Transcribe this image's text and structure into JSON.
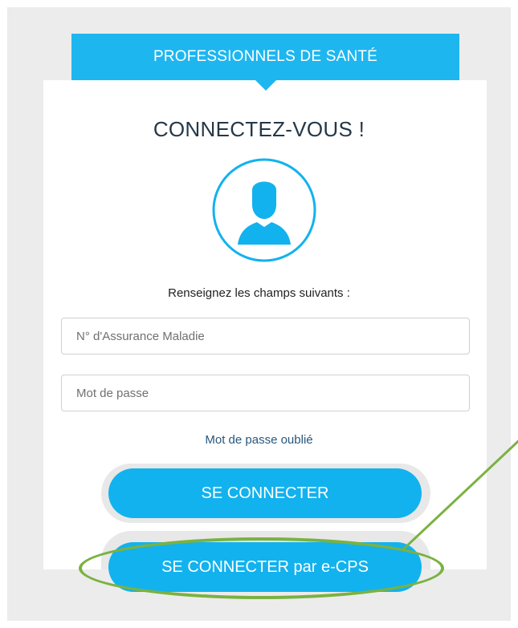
{
  "header": {
    "title": "PROFESSIONNELS DE SANTÉ"
  },
  "login": {
    "title": "CONNECTEZ-VOUS !",
    "instructions": "Renseignez les champs suivants :",
    "fields": {
      "insurance_number_placeholder": "N° d'Assurance Maladie",
      "password_placeholder": "Mot de passe"
    },
    "forgot_password": "Mot de passe oublié",
    "connect_button": "SE CONNECTER",
    "ecps_button": "SE CONNECTER par e-CPS"
  },
  "icons": {
    "avatar": "user-silhouette-icon"
  },
  "colors": {
    "brand_blue": "#12b2ee",
    "header_blue": "#1eb6ef",
    "title_text": "#243848",
    "link_text": "#27577d",
    "annotation_green": "#7ab241",
    "page_background": "#ececec"
  }
}
